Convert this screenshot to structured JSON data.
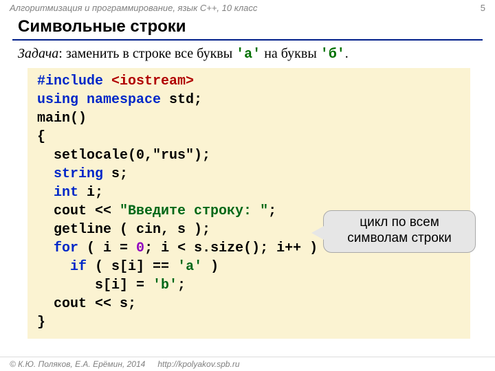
{
  "header": {
    "course": "Алгоритмизация и программирование, язык C++, 10 класс",
    "page": "5"
  },
  "title": "Символьные строки",
  "task": {
    "label": "Задача",
    "before": ": заменить в строке все буквы ",
    "a": "'а'",
    "mid": " на буквы ",
    "b": "'б'",
    "after": "."
  },
  "code": {
    "l1_a": "#include ",
    "l1_b": "<iostream>",
    "l2_a": "using namespace",
    "l2_b": " std;",
    "l3": "main()",
    "l4": "{",
    "l5": "  setlocale(0,\"rus\");",
    "l6_a": "  ",
    "l6_b": "string",
    "l6_c": " s;",
    "l7_a": "  ",
    "l7_b": "int",
    "l7_c": " i;",
    "l8_a": "  cout << ",
    "l8_b": "\"Введите строку: \"",
    "l8_c": ";",
    "l9_a": "  getline",
    "l9_b": " ( cin, s );",
    "l10_a": "  ",
    "l10_b": "for",
    "l10_c": " ( i = ",
    "l10_d": "0",
    "l10_e": "; i < s.size(); i++ )",
    "l11_a": "    ",
    "l11_b": "if",
    "l11_c": " ( s[i] == ",
    "l11_d": "'а'",
    "l11_e": " )",
    "l12_a": "       s[i] = ",
    "l12_b": "'b'",
    "l12_c": ";",
    "l13": "  cout << s;",
    "l14": "}"
  },
  "callout": {
    "line1": "цикл по всем",
    "line2": "символам строки"
  },
  "footer": {
    "copyright": "© К.Ю. Поляков, Е.А. Ерёмин, 2014",
    "url": "http://kpolyakov.spb.ru"
  }
}
